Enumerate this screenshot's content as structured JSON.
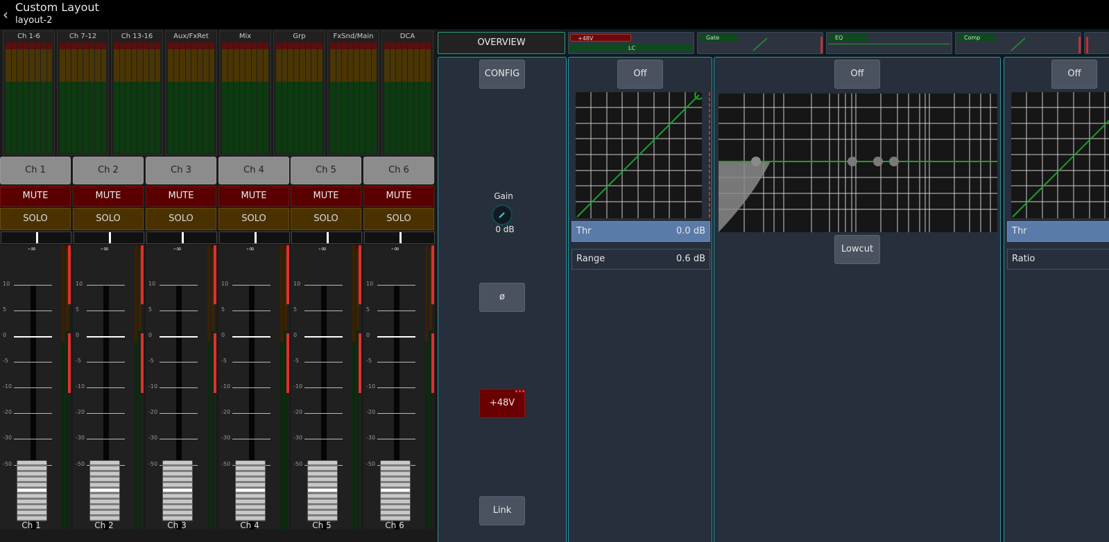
{
  "header": {
    "title": "Custom Layout",
    "subtitle": "layout-2"
  },
  "groups": [
    {
      "label": "Ch 1-6"
    },
    {
      "label": "Ch 7-12"
    },
    {
      "label": "Ch 13-16"
    },
    {
      "label": "Aux/FxRet"
    },
    {
      "label": "Mix"
    },
    {
      "label": "Grp"
    },
    {
      "label": "FxSnd/Main"
    },
    {
      "label": "DCA"
    }
  ],
  "channels": [
    {
      "name": "Ch 1",
      "mute": "MUTE",
      "solo": "SOLO",
      "level": "-∞"
    },
    {
      "name": "Ch 2",
      "mute": "MUTE",
      "solo": "SOLO",
      "level": "-∞"
    },
    {
      "name": "Ch 3",
      "mute": "MUTE",
      "solo": "SOLO",
      "level": "-∞"
    },
    {
      "name": "Ch 4",
      "mute": "MUTE",
      "solo": "SOLO",
      "level": "-∞"
    },
    {
      "name": "Ch 5",
      "mute": "MUTE",
      "solo": "SOLO",
      "level": "-∞"
    },
    {
      "name": "Ch 6",
      "mute": "MUTE",
      "solo": "SOLO",
      "level": "-∞"
    }
  ],
  "fader_scale": [
    "10",
    "5",
    "0",
    "-5",
    "-10",
    "-20",
    "-30",
    "-50"
  ],
  "overview": {
    "label": "OVERVIEW"
  },
  "tabs": {
    "phantom_pill": "+48V",
    "lc_pill": "LC",
    "gate": "Gate",
    "eq": "EQ",
    "comp": "Comp"
  },
  "config": {
    "config_button": "CONFIG",
    "gain_label": "Gain",
    "gain_value": "0 dB",
    "phase_button": "ø",
    "phantom_button": "+48V",
    "link_button": "Link"
  },
  "gate": {
    "toggle": "Off",
    "threshold_label": "Thr",
    "threshold_value": "0.0 dB",
    "range_label": "Range",
    "range_value": "0.6 dB"
  },
  "eq": {
    "toggle": "Off",
    "lowcut_button": "Lowcut"
  },
  "comp": {
    "toggle": "Off",
    "threshold_label": "Thr",
    "ratio_label": "Ratio"
  },
  "colors": {
    "accent": "#2c97a6",
    "mute": "#5a0000",
    "solo": "#4a3100",
    "curve": "#1fa02a"
  }
}
